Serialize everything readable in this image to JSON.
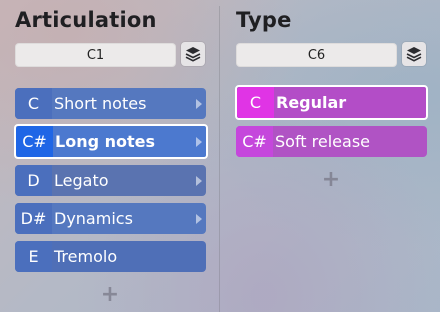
{
  "articulation": {
    "title": "Articulation",
    "key": "C1",
    "items": [
      {
        "note": "C",
        "label": "Short notes",
        "has_submenu": true
      },
      {
        "note": "C#",
        "label": "Long notes",
        "has_submenu": true
      },
      {
        "note": "D",
        "label": "Legato",
        "has_submenu": true
      },
      {
        "note": "D#",
        "label": "Dynamics",
        "has_submenu": true
      },
      {
        "note": "E",
        "label": "Tremolo",
        "has_submenu": false
      }
    ],
    "selected_index": 1,
    "add_label": "+"
  },
  "type": {
    "title": "Type",
    "key": "C6",
    "items": [
      {
        "note": "C",
        "label": "Regular"
      },
      {
        "note": "C#",
        "label": "Soft release"
      }
    ],
    "selected_index": 0,
    "add_label": "+"
  },
  "colors": {
    "articulation_accent": "#4c79cf",
    "type_accent": "#b34dc7",
    "selected_outline": "#ffffff"
  },
  "icons": [
    "layers-icon",
    "chevron-right-icon",
    "plus-icon"
  ]
}
